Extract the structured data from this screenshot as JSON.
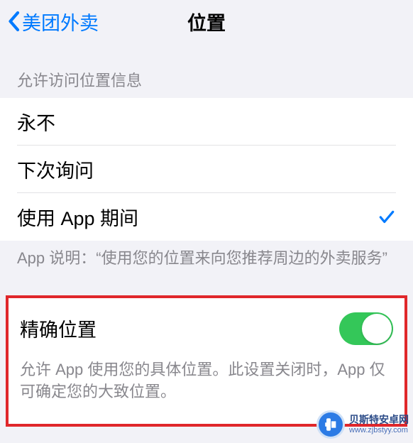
{
  "nav": {
    "back_label": "美团外卖",
    "title": "位置"
  },
  "location_access": {
    "header": "允许访问位置信息",
    "options": [
      {
        "label": "永不",
        "selected": false
      },
      {
        "label": "下次询问",
        "selected": false
      },
      {
        "label": "使用 App 期间",
        "selected": true
      }
    ],
    "footer": "App 说明：“使用您的位置来向您推荐周边的外卖服务”"
  },
  "precise": {
    "label": "精确位置",
    "enabled": true,
    "footer": "允许 App 使用您的具体位置。此设置关闭时，App 仅可确定您的大致位置。"
  },
  "watermark": {
    "name": "贝斯特安卓网",
    "url": "www.zjbstyy.com"
  }
}
